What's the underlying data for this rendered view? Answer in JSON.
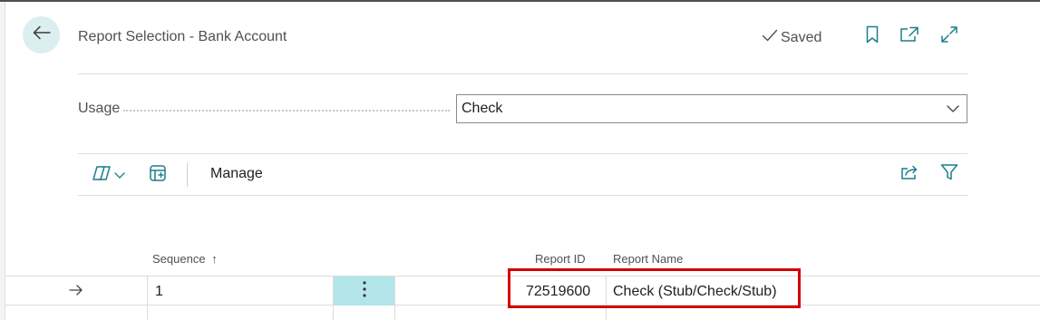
{
  "header": {
    "title": "Report Selection - Bank Account",
    "status": "Saved",
    "icons": [
      "back-arrow-icon",
      "check-icon",
      "bookmark-icon",
      "open-new-window-icon",
      "expand-icon"
    ]
  },
  "usage": {
    "label": "Usage",
    "selected": "Check"
  },
  "toolbar": {
    "manage_label": "Manage",
    "icons": [
      "copilot-icon",
      "chevron-down-icon",
      "new-line-icon",
      "share-icon",
      "filter-icon"
    ]
  },
  "grid": {
    "columns": {
      "sequence": "Sequence",
      "sort_indicator": "↑",
      "report_id": "Report ID",
      "report_name": "Report Name"
    },
    "rows": [
      {
        "sequence": "1",
        "report_id": "72519600",
        "report_name": "Check (Stub/Check/Stub)"
      }
    ]
  },
  "colors": {
    "accent": "#b2e6ea",
    "back_button_bg": "#dbeef0",
    "highlight": "#d30000",
    "icon": "#1a7f8c"
  }
}
